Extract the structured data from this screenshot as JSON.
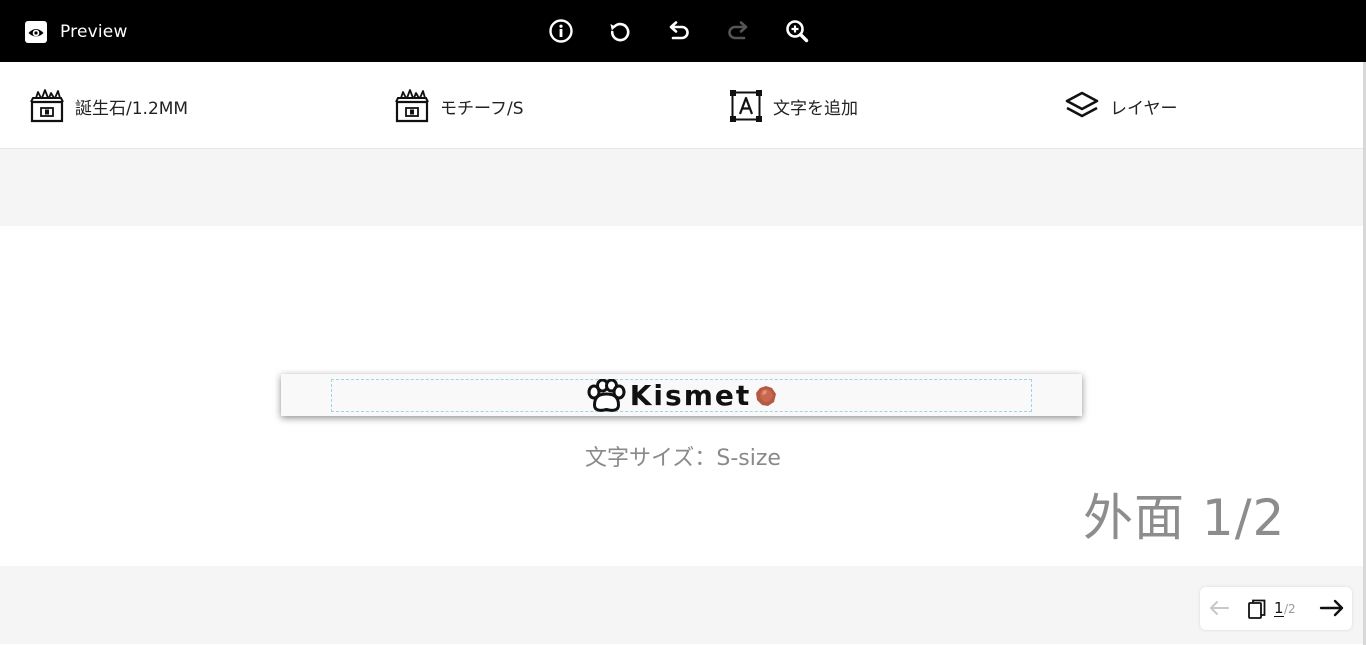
{
  "topbar": {
    "preview_label": "Preview",
    "tools": [
      {
        "icon": "info-icon"
      },
      {
        "icon": "reset-icon"
      },
      {
        "icon": "undo-icon"
      },
      {
        "icon": "redo-icon",
        "disabled": true
      },
      {
        "icon": "zoom-in-icon"
      }
    ]
  },
  "toolbar": {
    "items": [
      {
        "label": "誕生石/1.2MM",
        "icon": "gem-box-icon"
      },
      {
        "label": "モチーフ/S",
        "icon": "motif-box-icon"
      },
      {
        "label": "文字を追加",
        "icon": "add-text-icon"
      },
      {
        "label": "レイヤー",
        "icon": "layers-icon"
      }
    ]
  },
  "canvas": {
    "engraving_text": "Kismet",
    "motif_icon": "paw-icon",
    "stone_icon": "birthstone-icon",
    "stone_color": "#c8694f",
    "guide_color": "#9ed3e8",
    "size_caption": "文字サイズ：S-size",
    "side_label": "外面 1/2"
  },
  "pager": {
    "current": "1",
    "total": "/2"
  }
}
